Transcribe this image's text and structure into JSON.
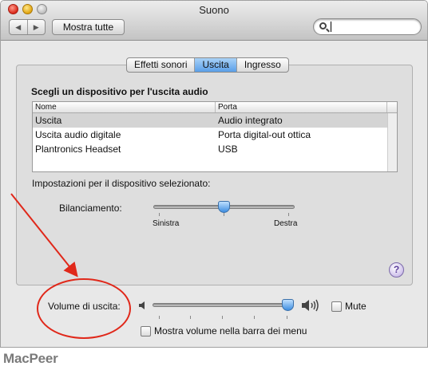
{
  "window": {
    "title": "Suono"
  },
  "toolbar": {
    "back_icon": "◀",
    "forward_icon": "▶",
    "show_all_label": "Mostra tutte",
    "search_value": ""
  },
  "tabs": [
    {
      "label": "Effetti sonori",
      "active": false
    },
    {
      "label": "Uscita",
      "active": true
    },
    {
      "label": "Ingresso",
      "active": false
    }
  ],
  "output": {
    "section_title": "Scegli un dispositivo per l'uscita audio",
    "columns": [
      "Nome",
      "Porta"
    ],
    "devices": [
      {
        "name": "Uscita",
        "port": "Audio integrato",
        "selected": true
      },
      {
        "name": "Uscita audio digitale",
        "port": "Porta digital-out ottica",
        "selected": false
      },
      {
        "name": "Plantronics Headset",
        "port": "USB",
        "selected": false
      }
    ],
    "settings_label": "Impostazioni per il dispositivo selezionato:",
    "balance": {
      "label": "Bilanciamento:",
      "left_label": "Sinistra",
      "right_label": "Destra",
      "value": 0.5
    }
  },
  "help": {
    "label": "?"
  },
  "volume": {
    "label": "Volume di uscita:",
    "value": 0.97,
    "mute_label": "Mute",
    "mute_checked": false,
    "menu_bar_label": "Mostra volume nella barra dei menu",
    "menu_bar_checked": false
  },
  "watermark": "MacPeer",
  "colors": {
    "accent": "#5a9ee8",
    "annotation": "#e0281a"
  }
}
